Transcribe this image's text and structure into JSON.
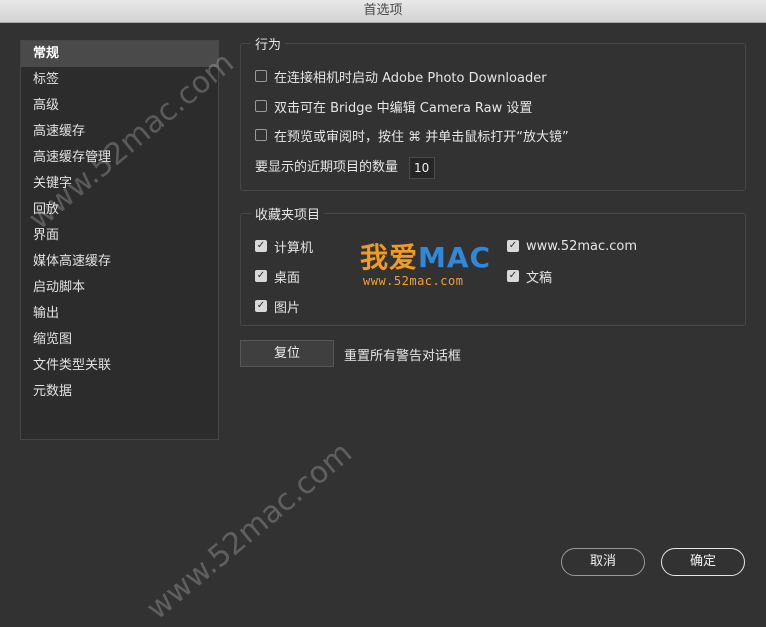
{
  "window": {
    "title": "首选项"
  },
  "sidebar": {
    "items": [
      {
        "label": "常规",
        "active": true
      },
      {
        "label": "标签"
      },
      {
        "label": "高级"
      },
      {
        "label": "高速缓存"
      },
      {
        "label": "高速缓存管理"
      },
      {
        "label": "关键字"
      },
      {
        "label": "回放"
      },
      {
        "label": "界面"
      },
      {
        "label": "媒体高速缓存"
      },
      {
        "label": "启动脚本"
      },
      {
        "label": "输出"
      },
      {
        "label": "缩览图"
      },
      {
        "label": "文件类型关联"
      },
      {
        "label": "元数据"
      }
    ]
  },
  "behavior": {
    "title": "行为",
    "options": [
      {
        "label": "在连接相机时启动 Adobe Photo Downloader",
        "checked": false
      },
      {
        "label": "双击可在 Bridge 中编辑 Camera Raw 设置",
        "checked": false
      },
      {
        "label": "在预览或审阅时，按住 ⌘ 并单击鼠标打开“放大镜”",
        "checked": false
      }
    ],
    "recent_label": "要显示的近期项目的数量",
    "recent_value": "10"
  },
  "favorites": {
    "title": "收藏夹项目",
    "left": [
      {
        "label": "计算机",
        "checked": true
      },
      {
        "label": "桌面",
        "checked": true
      },
      {
        "label": "图片",
        "checked": true
      }
    ],
    "right": [
      {
        "label": "www.52mac.com",
        "checked": true
      },
      {
        "label": "文稿",
        "checked": true
      }
    ]
  },
  "reset": {
    "button": "复位",
    "label": "重置所有警告对话框"
  },
  "footer": {
    "cancel": "取消",
    "ok": "确定"
  },
  "logo": {
    "zh": "我爱",
    "en": "MAC",
    "url": "www.52mac.com"
  },
  "watermark": {
    "text": "www.52mac.com"
  }
}
